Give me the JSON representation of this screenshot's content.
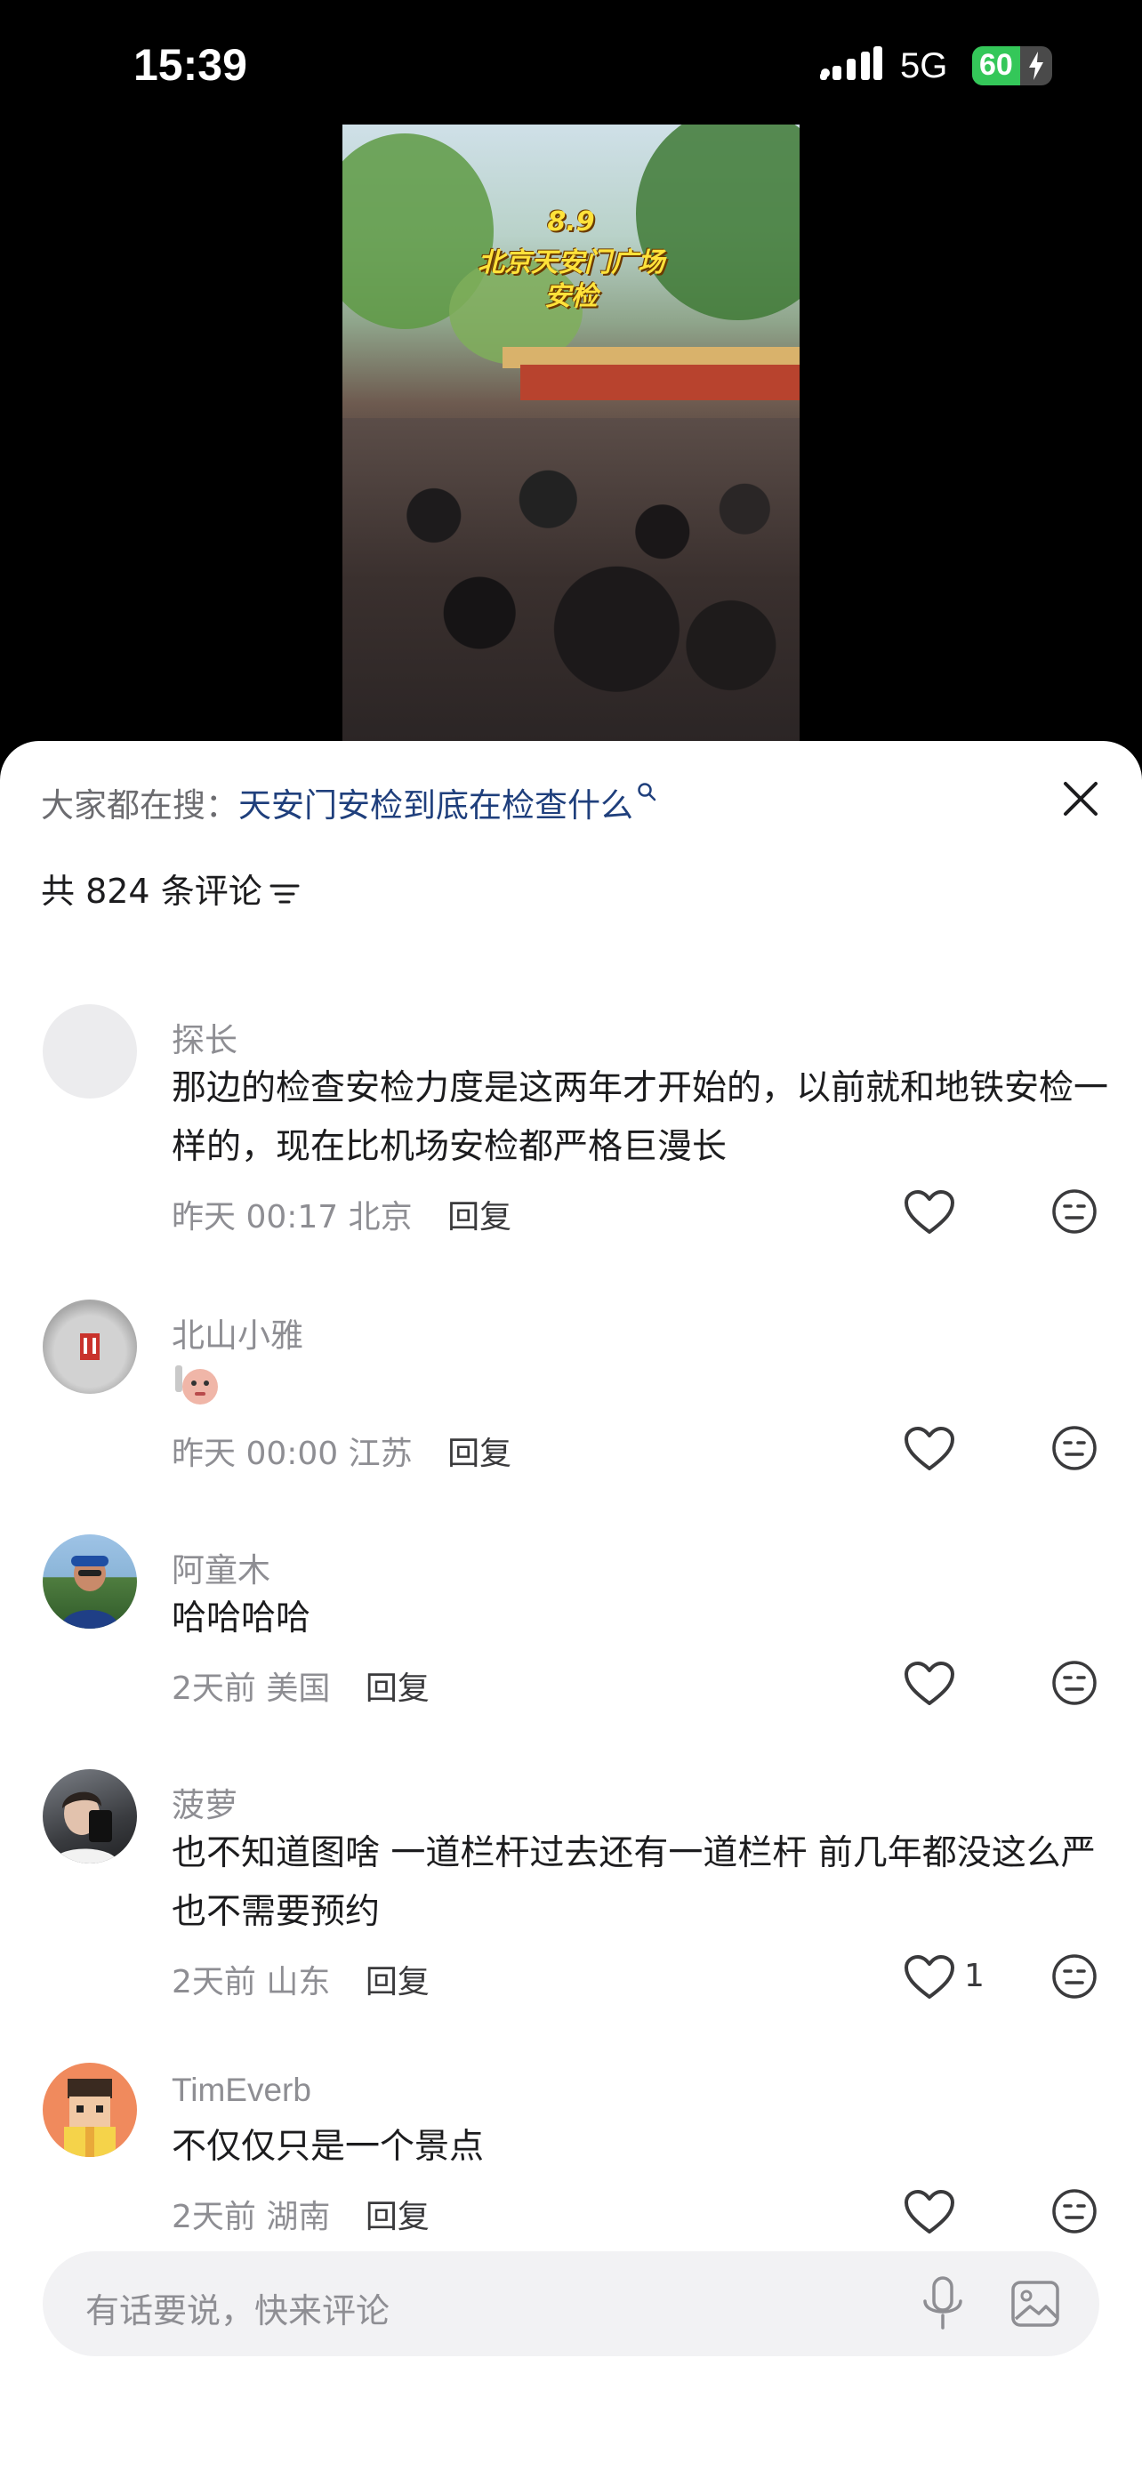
{
  "status_bar": {
    "time": "15:39",
    "network": "5G",
    "battery_level": "60",
    "battery_percent": 60,
    "battery_color": "#34c759"
  },
  "video": {
    "caption_date": "8.9",
    "caption_line1": "北京天安门广场",
    "caption_line2": "安检"
  },
  "comments_panel": {
    "trending_label": "大家都在搜：",
    "trending_link": "天安门安检到底在检查什么",
    "count_text": "共 824 条评论",
    "close_icon": "close-icon",
    "sort_icon": "sort-lines-icon"
  },
  "comments": [
    {
      "username": "探长",
      "text": "那边的检查安检力度是这两年才开始的，以前就和地铁安检一样的，现在比机场安检都严格巨漫长",
      "time": "昨天 00:17",
      "location": "北京",
      "reply_label": "回复",
      "likes": ""
    },
    {
      "username": "北山小雅",
      "text": "",
      "time": "昨天 00:00",
      "location": "江苏",
      "reply_label": "回复",
      "likes": ""
    },
    {
      "username": "阿童木",
      "text": "哈哈哈哈",
      "time": "2天前",
      "location": "美国",
      "reply_label": "回复",
      "likes": ""
    },
    {
      "username": "菠萝",
      "text": "也不知道图啥 一道栏杆过去还有一道栏杆 前几年都没这么严也不需要预约",
      "time": "2天前",
      "location": "山东",
      "reply_label": "回复",
      "likes": "1"
    },
    {
      "username": "TimEverb",
      "text": "不仅仅只是一个景点",
      "time": "2天前",
      "location": "湖南",
      "reply_label": "回复",
      "likes": ""
    }
  ],
  "input": {
    "placeholder": "有话要说，快来评论"
  },
  "colors": {
    "link": "#1f3f7c",
    "muted": "#8e8e93",
    "text": "#1c1c1e"
  }
}
